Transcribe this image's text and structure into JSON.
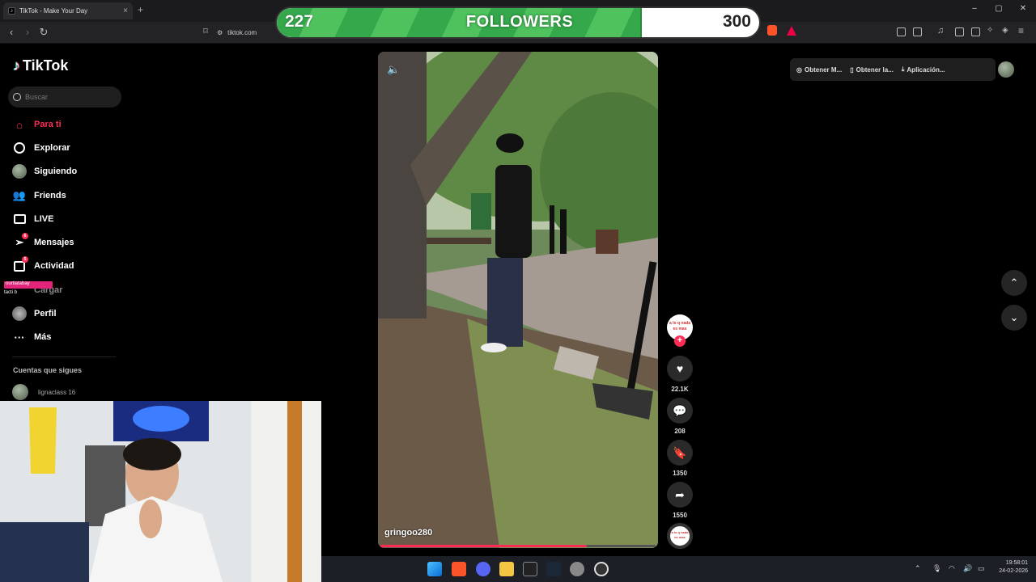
{
  "browser": {
    "tab_title": "TikTok - Make Your Day",
    "url": "tiktok.com"
  },
  "followers_goal": {
    "current": "227",
    "label": "FOLLOWERS",
    "target": "300",
    "progress_fraction": 0.757
  },
  "sidebar": {
    "logo": "TikTok",
    "search_placeholder": "Buscar",
    "items": [
      {
        "label": "Para ti",
        "icon": "home-icon"
      },
      {
        "label": "Explorar",
        "icon": "compass-icon"
      },
      {
        "label": "Siguiendo",
        "icon": "avatar-icon"
      },
      {
        "label": "Friends",
        "icon": "friends-icon"
      },
      {
        "label": "LIVE",
        "icon": "live-icon"
      },
      {
        "label": "Mensajes",
        "icon": "send-icon",
        "badge": "6"
      },
      {
        "label": "Actividad",
        "icon": "inbox-icon",
        "badge": "5"
      },
      {
        "label": "Cargar",
        "icon": "upload-icon"
      },
      {
        "label": "Perfil",
        "icon": "profile-icon"
      },
      {
        "label": "Más",
        "icon": "more-icon"
      }
    ],
    "following_title": "Cuentas que sigues",
    "following_accounts": [
      {
        "name": "lignaclass 16"
      }
    ]
  },
  "top_right": {
    "get_coins": "Obtener M...",
    "get_app": "Obtener la...",
    "desktop_app": "Aplicación..."
  },
  "video": {
    "author": "gringoo280",
    "progress_fraction": 0.75
  },
  "actions": {
    "likes": "22.1K",
    "comments": "208",
    "saves": "1350",
    "shares": "1550",
    "creator_avatar_text": "a lo q nada es mas"
  },
  "stream_overlay": {
    "tag": "ourtiatabay",
    "sub": "tacti b"
  },
  "taskbar": {
    "time": "19:58:01",
    "date": "24-02-2026"
  },
  "colors": {
    "tiktok_red": "#fe2c55",
    "goal_green": "#3fb650"
  }
}
